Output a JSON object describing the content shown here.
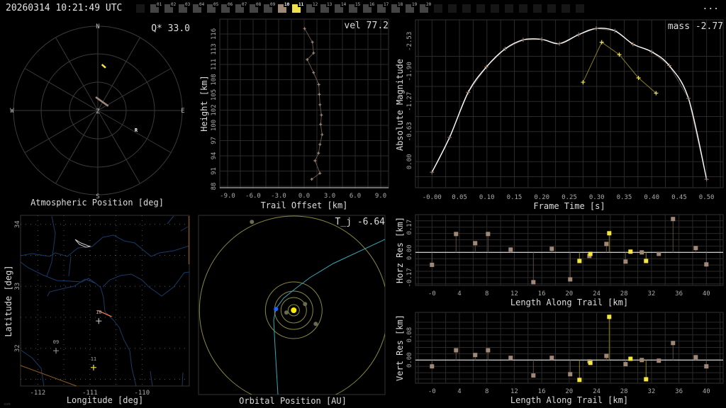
{
  "header": {
    "timestamp": "20260314 10:21:49 UTC",
    "menu_label": "...",
    "stations": [
      {
        "label": "01",
        "state": "idle"
      },
      {
        "label": "02",
        "state": "idle"
      },
      {
        "label": "03",
        "state": "idle"
      },
      {
        "label": "04",
        "state": "idle"
      },
      {
        "label": "05",
        "state": "idle"
      },
      {
        "label": "06",
        "state": "idle"
      },
      {
        "label": "07",
        "state": "idle"
      },
      {
        "label": "08",
        "state": "idle"
      },
      {
        "label": "09",
        "state": "idle"
      },
      {
        "label": "10",
        "state": "active"
      },
      {
        "label": "11",
        "state": "selected"
      },
      {
        "label": "12",
        "state": "idle"
      },
      {
        "label": "13",
        "state": "idle"
      },
      {
        "label": "14",
        "state": "idle"
      },
      {
        "label": "15",
        "state": "idle"
      },
      {
        "label": "16",
        "state": "idle"
      },
      {
        "label": "17",
        "state": "idle"
      },
      {
        "label": "18",
        "state": "idle"
      },
      {
        "label": "19",
        "state": "idle"
      },
      {
        "label": "20",
        "state": "idle"
      }
    ],
    "empty_slots": 11
  },
  "colors": {
    "station_idle": "#444444",
    "station_active": "#a08878",
    "station_selected": "#f0e050",
    "series_primary": "#a08878",
    "series_secondary": "#f5e642",
    "fit_line": "#ffffff",
    "grid": "#2a2a2a",
    "river": "#1a3a66",
    "orbit": "#8a8a40",
    "trajectory": "#3aa6b8",
    "earth": "#1a66ff",
    "sun": "#ffee00"
  },
  "panels": {
    "atmospheric": {
      "title": "Atmospheric Position [deg]",
      "readout": "Q* 33.0"
    },
    "trail": {
      "readout": "vel 77.2"
    },
    "magnitude": {
      "readout": "mass -2.77"
    },
    "map": {
      "xlabel": "Longitude [deg]",
      "ylabel": "Latitude [deg]",
      "attribution": "osm"
    },
    "orbit": {
      "title": "Orbital Position [AU]",
      "readout": "T_j -6.64"
    }
  },
  "chart_data": [
    {
      "id": "polar",
      "type": "scatter",
      "title": "Atmospheric Position [deg]",
      "compass": [
        "N",
        "E",
        "S",
        "W"
      ],
      "zenith_label": "Z",
      "radiant_label": "R",
      "radiant": {
        "az": 116.6,
        "zd": 45.7
      },
      "tracks": [
        {
          "name": "10",
          "points": [
            {
              "az": 351,
              "zd": 14.5
            },
            {
              "az": 66.8,
              "zd": 12.1
            }
          ]
        },
        {
          "name": "11",
          "points": [
            {
              "az": 5,
              "zd": 49.3
            },
            {
              "az": 10.3,
              "zd": 46.4
            }
          ]
        }
      ]
    },
    {
      "id": "trail",
      "type": "line",
      "xlabel": "Trail Offset [km]",
      "ylabel": "Height [km]",
      "xlim": [
        -10,
        10
      ],
      "ylim": [
        88,
        117.5
      ],
      "xticks": [
        "-9.0",
        "-6.0",
        "-3.0",
        "0.0",
        "3.0",
        "6.0",
        "9.0"
      ],
      "xtick_values": [
        -9,
        -6,
        -3,
        0,
        3,
        6,
        9
      ],
      "yticks": [
        "88",
        "91",
        "94",
        "97",
        "100",
        "102",
        "105",
        "108",
        "111",
        "113",
        "116"
      ],
      "yrange_ticks": [
        88,
        116
      ],
      "series": [
        {
          "name": "10",
          "x": [
            0.05,
            0.97,
            1.11,
            0.36,
            1.11,
            1.72,
            1.78,
            1.86,
            2.03,
            1.94,
            2.11,
            1.86,
            1.69,
            1.28,
            1.86,
            0.89
          ],
          "y": [
            117.0,
            114.5,
            112.5,
            111.3,
            108.9,
            106.7,
            104.9,
            103.0,
            101.1,
            99.4,
            97.5,
            95.7,
            94.1,
            92.7,
            90.4,
            89.3
          ]
        }
      ]
    },
    {
      "id": "magnitude",
      "type": "line",
      "xlabel": "Frame Time [s]",
      "ylabel": "Absolute Magnitude",
      "xlim": [
        -0.03,
        0.53
      ],
      "ylim": [
        0.55,
        -2.98
      ],
      "xticks": [
        "-0.00",
        "0.05",
        "0.10",
        "0.15",
        "0.20",
        "0.25",
        "0.30",
        "0.35",
        "0.40",
        "0.45",
        "0.50"
      ],
      "yticks": [
        "0.00",
        "-0.63",
        "-1.27",
        "-1.90",
        "-2.53"
      ],
      "series": [
        {
          "name": "10",
          "x": [
            0,
            0.032,
            0.066,
            0.099,
            0.133,
            0.166,
            0.2,
            0.232,
            0.267,
            0.299,
            0.333,
            0.366,
            0.4,
            0.432,
            0.467,
            0.5
          ],
          "y": [
            0.22,
            -0.51,
            -1.46,
            -1.99,
            -2.37,
            -2.56,
            -2.57,
            -2.48,
            -2.67,
            -2.8,
            -2.75,
            -2.47,
            -2.31,
            -2.02,
            -1.33,
            0.37
          ]
        },
        {
          "name": "11",
          "x": [
            0.275,
            0.309,
            0.341,
            0.376,
            0.408
          ],
          "y": [
            -1.67,
            -2.51,
            -2.25,
            -1.76,
            -1.44
          ]
        }
      ]
    },
    {
      "id": "horz_res",
      "type": "scatter",
      "xlabel": "Length Along Trail [km]",
      "ylabel": "Horz Res [km]",
      "xlim": [
        -2.4,
        42.4
      ],
      "ylim": [
        -0.225,
        0.25
      ],
      "xticks": [
        "-0",
        "4",
        "8",
        "12",
        "16",
        "20",
        "24",
        "28",
        "32",
        "36",
        "40"
      ],
      "yticks": [
        "-0.17",
        "0.00",
        "0.17"
      ],
      "ytick_values": [
        -0.17,
        0,
        0.17
      ],
      "points": [
        {
          "x": 0,
          "y": -0.084,
          "s": "10"
        },
        {
          "x": 3.51,
          "y": 0.124,
          "s": "10"
        },
        {
          "x": 6.3,
          "y": 0.062,
          "s": "10"
        },
        {
          "x": 8.17,
          "y": 0.124,
          "s": "10"
        },
        {
          "x": 11.47,
          "y": 0.019,
          "s": "10"
        },
        {
          "x": 14.78,
          "y": -0.201,
          "s": "10"
        },
        {
          "x": 17.47,
          "y": 0.024,
          "s": "10"
        },
        {
          "x": 20.15,
          "y": -0.182,
          "s": "10"
        },
        {
          "x": 21.5,
          "y": -0.058,
          "s": "11"
        },
        {
          "x": 22.95,
          "y": -0.024,
          "s": "10"
        },
        {
          "x": 23.09,
          "y": -0.01,
          "s": "11"
        },
        {
          "x": 25.43,
          "y": 0.057,
          "s": "10"
        },
        {
          "x": 25.84,
          "y": 0.129,
          "s": "11"
        },
        {
          "x": 28.22,
          "y": -0.062,
          "s": "10"
        },
        {
          "x": 28.94,
          "y": 0.005,
          "s": "11"
        },
        {
          "x": 30.59,
          "y": 0.0,
          "s": "10"
        },
        {
          "x": 31.21,
          "y": -0.058,
          "s": "11"
        },
        {
          "x": 33.07,
          "y": -0.01,
          "s": "10"
        },
        {
          "x": 35.14,
          "y": 0.225,
          "s": "10"
        },
        {
          "x": 38.45,
          "y": 0.029,
          "s": "10"
        },
        {
          "x": 40,
          "y": -0.081,
          "s": "10"
        }
      ]
    },
    {
      "id": "vert_res",
      "type": "scatter",
      "xlabel": "Length Along Trail [km]",
      "ylabel": "Vert Res [km]",
      "xlim": [
        -2.4,
        42.4
      ],
      "ylim": [
        -0.074,
        0.151
      ],
      "xticks": [
        "-0",
        "4",
        "8",
        "12",
        "16",
        "20",
        "24",
        "28",
        "32",
        "36",
        "40"
      ],
      "yticks": [
        "0.00",
        "0.08"
      ],
      "ytick_values": [
        0,
        0.08
      ],
      "points": [
        {
          "x": 0,
          "y": -0.02,
          "s": "10"
        },
        {
          "x": 3.51,
          "y": 0.031,
          "s": "10"
        },
        {
          "x": 6.3,
          "y": 0.016,
          "s": "10"
        },
        {
          "x": 8.17,
          "y": 0.031,
          "s": "10"
        },
        {
          "x": 11.47,
          "y": 0.007,
          "s": "10"
        },
        {
          "x": 14.78,
          "y": -0.049,
          "s": "10"
        },
        {
          "x": 17.47,
          "y": 0.007,
          "s": "10"
        },
        {
          "x": 20.15,
          "y": -0.045,
          "s": "10"
        },
        {
          "x": 21.5,
          "y": -0.063,
          "s": "11"
        },
        {
          "x": 22.95,
          "y": -0.004,
          "s": "10"
        },
        {
          "x": 23.09,
          "y": -0.009,
          "s": "11"
        },
        {
          "x": 25.43,
          "y": 0.013,
          "s": "10"
        },
        {
          "x": 25.84,
          "y": 0.137,
          "s": "11"
        },
        {
          "x": 28.22,
          "y": -0.013,
          "s": "10"
        },
        {
          "x": 28.94,
          "y": 0.004,
          "s": "11"
        },
        {
          "x": 30.59,
          "y": 0.0,
          "s": "10"
        },
        {
          "x": 31.21,
          "y": -0.061,
          "s": "11"
        },
        {
          "x": 33.07,
          "y": -0.002,
          "s": "10"
        },
        {
          "x": 35.14,
          "y": 0.054,
          "s": "10"
        },
        {
          "x": 38.45,
          "y": 0.009,
          "s": "10"
        },
        {
          "x": 40,
          "y": -0.02,
          "s": "10"
        }
      ]
    },
    {
      "id": "map",
      "type": "scatter",
      "xlabel": "Longitude [deg]",
      "ylabel": "Latitude [deg]",
      "xlim": [
        -112.33,
        -109.09
      ],
      "ylim": [
        31.39,
        34.14
      ],
      "xticks": [
        "-112",
        "-111",
        "-110"
      ],
      "xtick_values": [
        -112,
        -111,
        -110
      ],
      "yticks": [
        "32",
        "33",
        "34"
      ],
      "ytick_values": [
        32,
        33,
        34
      ],
      "stations": [
        {
          "label": "09",
          "lon": -111.65,
          "lat": 31.96,
          "s": "idle"
        },
        {
          "label": "10",
          "lon": -110.83,
          "lat": 32.44,
          "s": "10"
        },
        {
          "label": "11",
          "lon": -110.93,
          "lat": 31.69,
          "s": "11"
        }
      ],
      "trail": [
        {
          "lon": -110.85,
          "lat": 32.61
        },
        {
          "lon": -110.58,
          "lat": 32.51
        }
      ]
    }
  ]
}
